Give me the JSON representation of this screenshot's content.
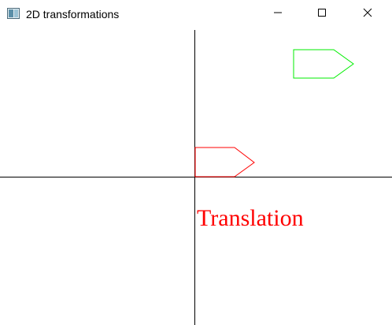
{
  "window": {
    "title": "2D transformations",
    "icon": "window-app-icon",
    "controls": {
      "minimize_icon": "minimize-icon",
      "maximize_icon": "maximize-icon",
      "close_icon": "close-icon"
    }
  },
  "scene": {
    "label": "Translation",
    "colors": {
      "axes": "#000000",
      "original": "#ff0000",
      "translated": "#00ee00",
      "label": "#ff0000"
    },
    "shape_legend": {
      "original": "original-pentagon-arrow",
      "translated": "translated-pentagon-arrow"
    }
  }
}
